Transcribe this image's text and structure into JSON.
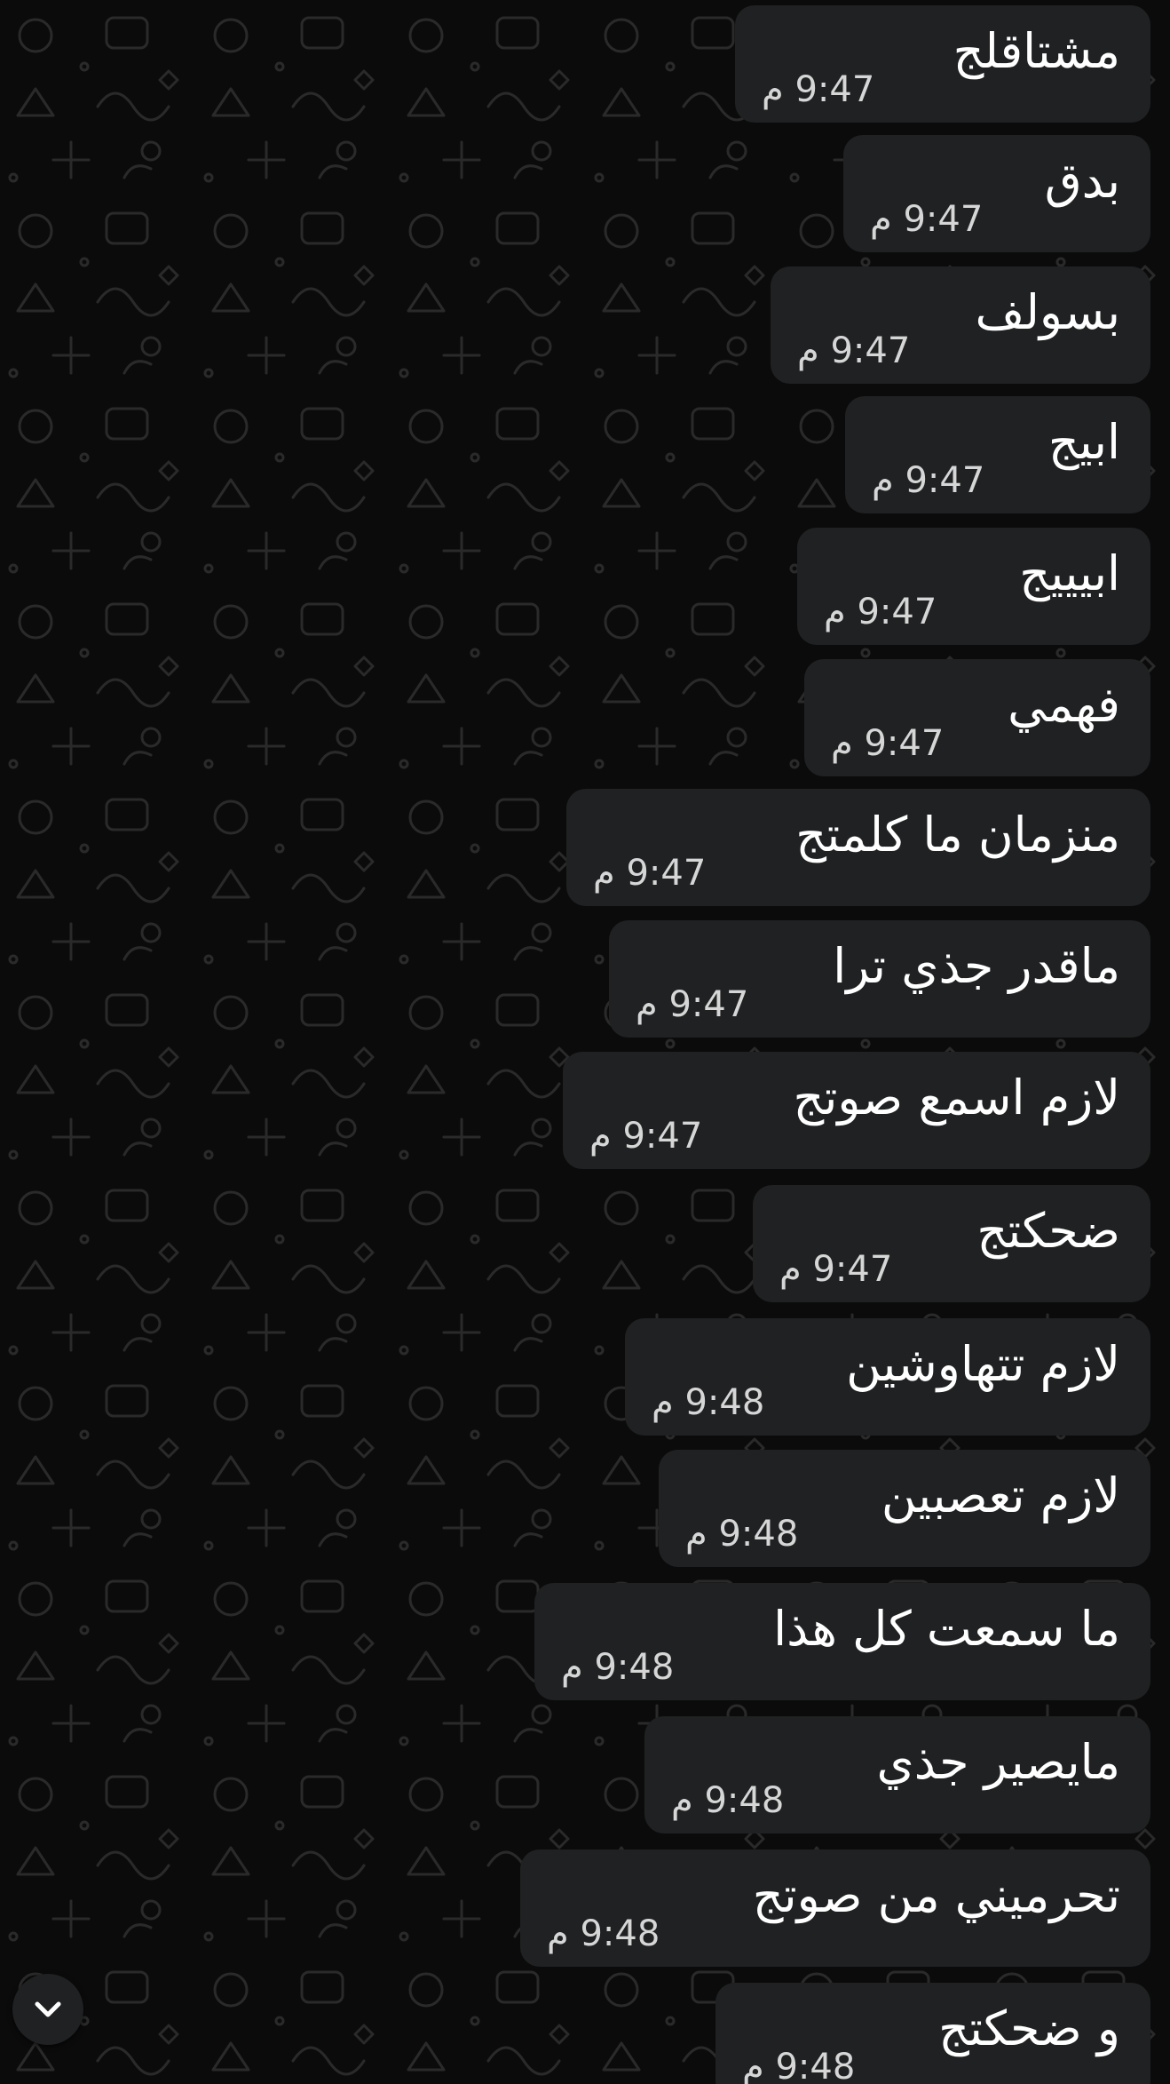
{
  "colors": {
    "background": "#0b0b0b",
    "bubble": "#1f2122",
    "text": "#ffffff",
    "meta_text": "#d6d6d6"
  },
  "messages": [
    {
      "text": "مشتاقلج",
      "time": "9:47",
      "period": "م"
    },
    {
      "text": "بدق",
      "time": "9:47",
      "period": "م"
    },
    {
      "text": "بسولف",
      "time": "9:47",
      "period": "م"
    },
    {
      "text": "ابيج",
      "time": "9:47",
      "period": "م"
    },
    {
      "text": "ابيييج",
      "time": "9:47",
      "period": "م"
    },
    {
      "text": "فهمي",
      "time": "9:47",
      "period": "م"
    },
    {
      "text": "منزمان ما كلمتج",
      "time": "9:47",
      "period": "م"
    },
    {
      "text": "ماقدر جذي ترا",
      "time": "9:47",
      "period": "م"
    },
    {
      "text": "لازم اسمع صوتج",
      "time": "9:47",
      "period": "م"
    },
    {
      "text": "ضحكتج",
      "time": "9:47",
      "period": "م"
    },
    {
      "text": "لازم تتهاوشين",
      "time": "9:48",
      "period": "م"
    },
    {
      "text": "لازم تعصبين",
      "time": "9:48",
      "period": "م"
    },
    {
      "text": "ما سمعت كل هذا",
      "time": "9:48",
      "period": "م"
    },
    {
      "text": "مايصير جذي",
      "time": "9:48",
      "period": "م"
    },
    {
      "text": "تحرميني من صوتج",
      "time": "9:48",
      "period": "م"
    },
    {
      "text": "و ضحكتج",
      "time": "9:48",
      "period": "م"
    }
  ],
  "scroll_button": {
    "icon": "chevron-down-icon"
  }
}
